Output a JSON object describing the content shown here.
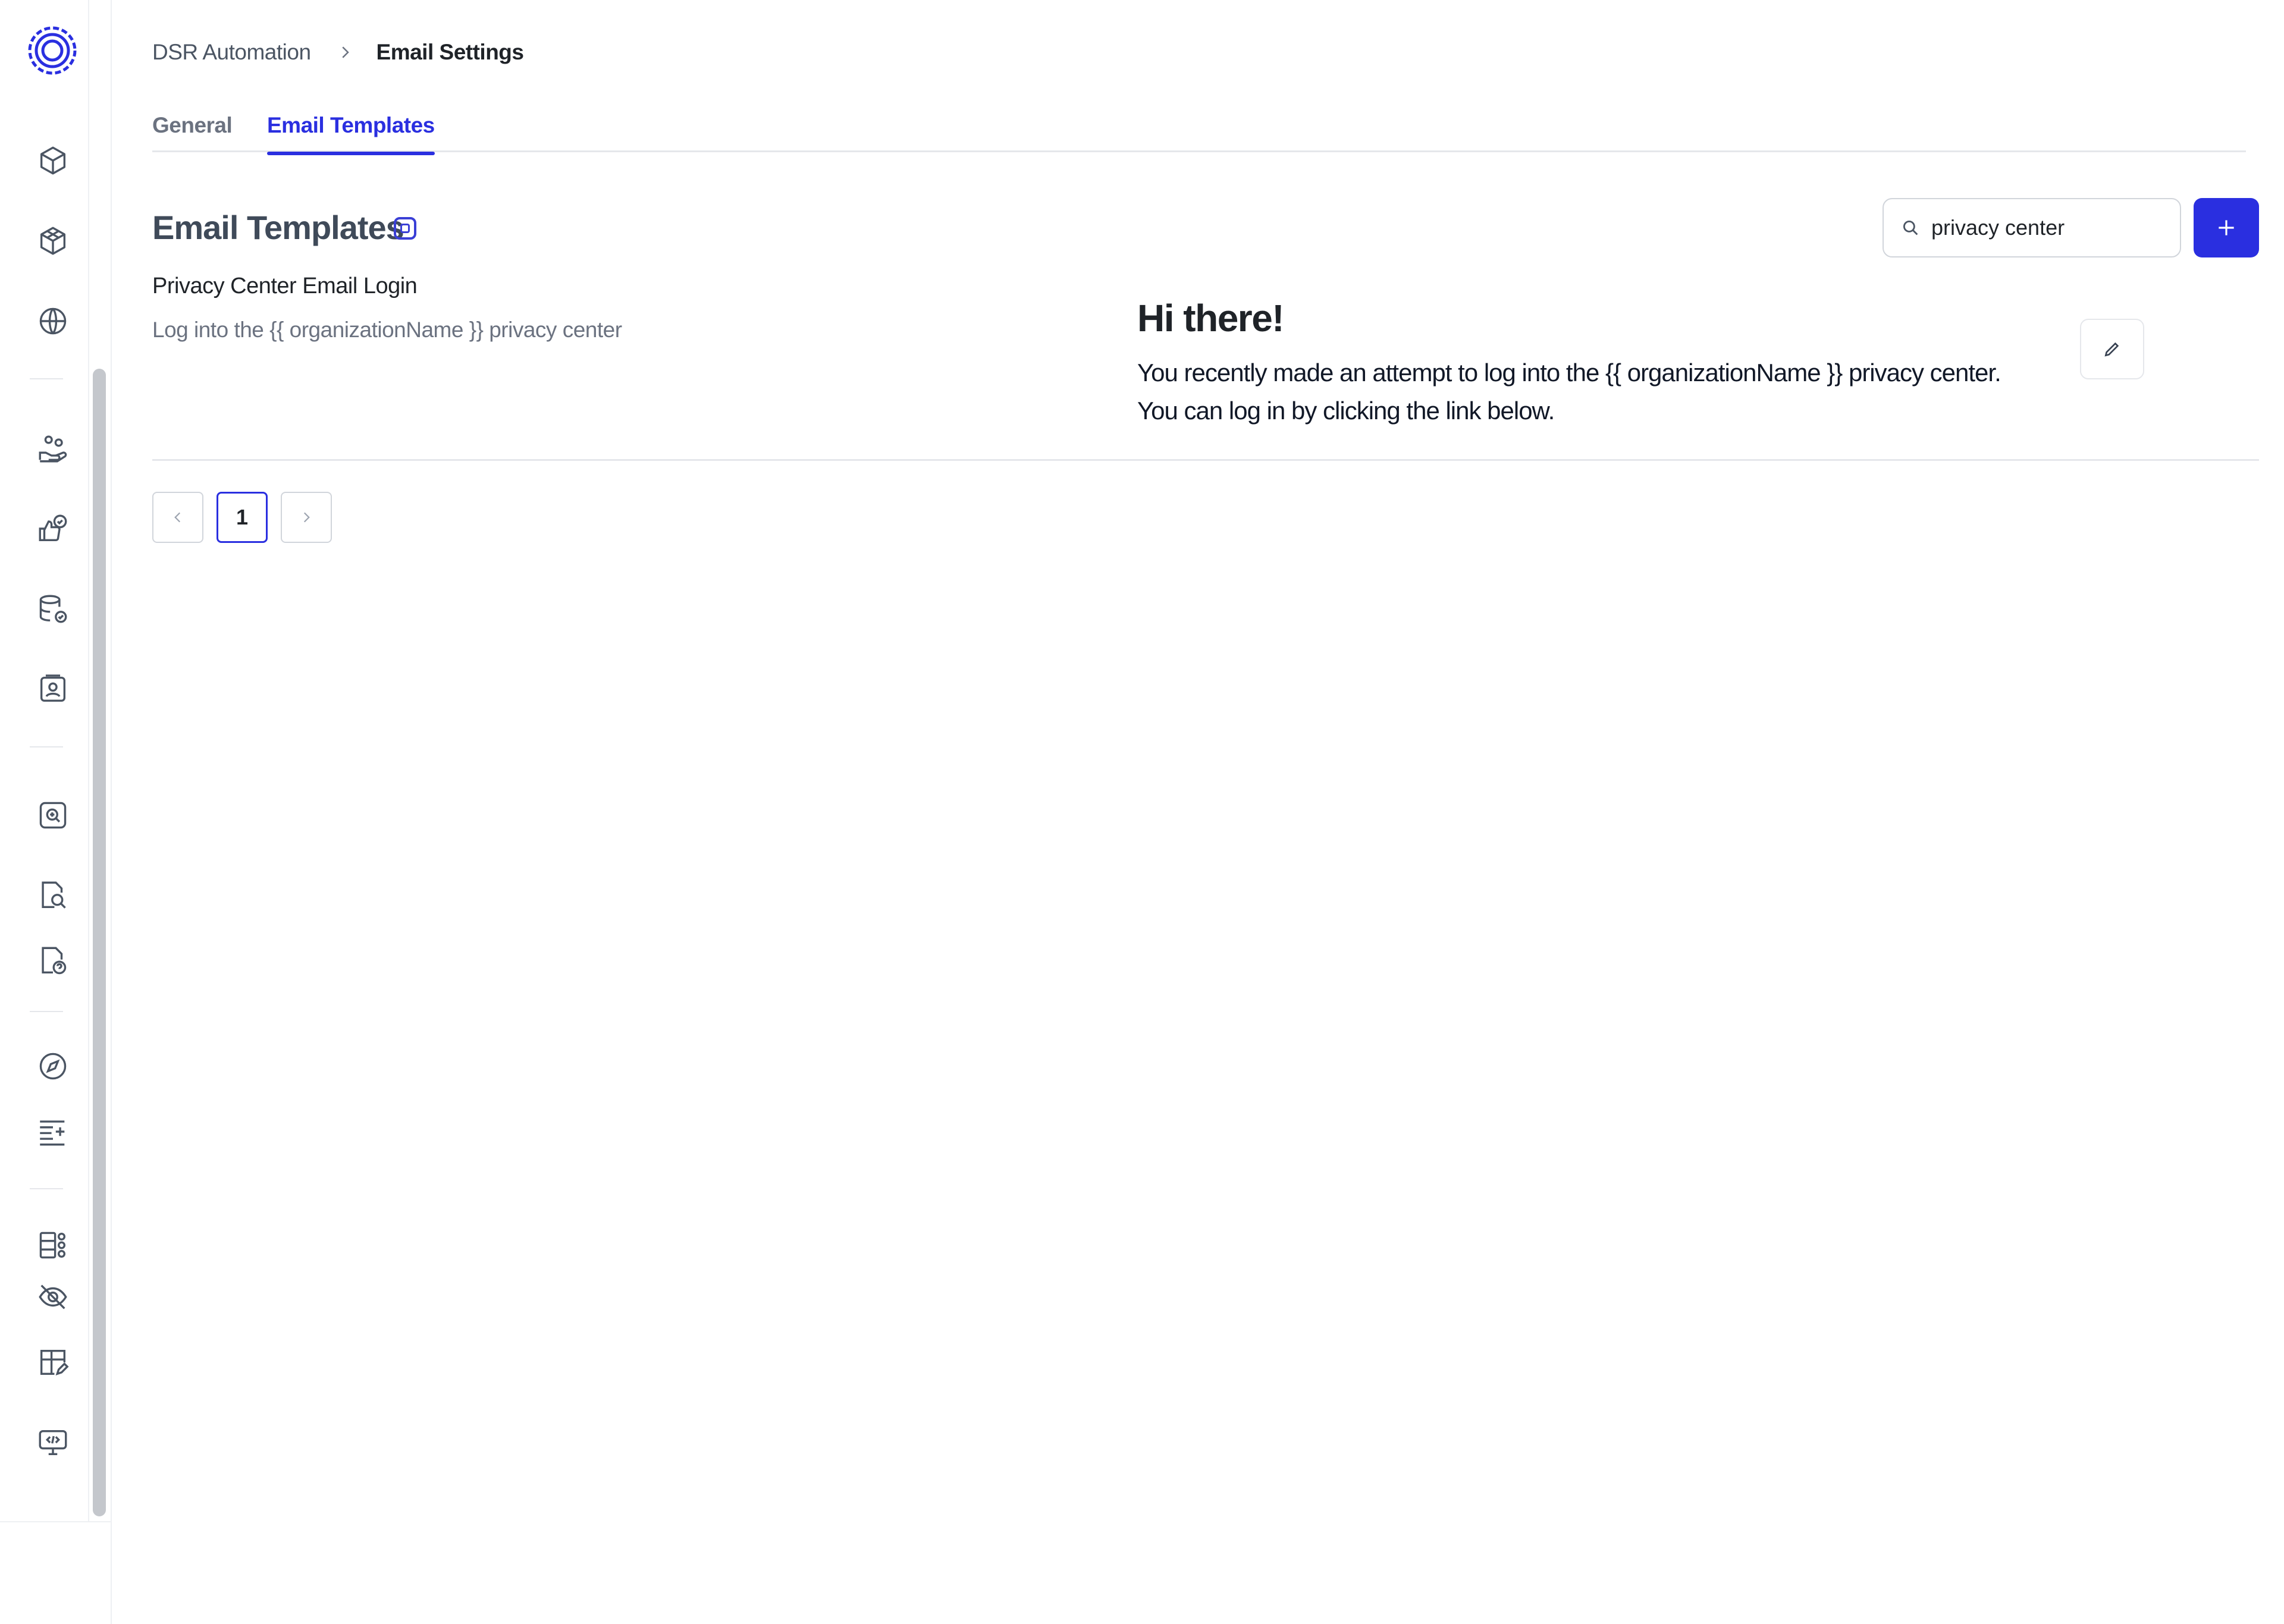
{
  "breadcrumb": {
    "parent": "DSR Automation",
    "current": "Email Settings"
  },
  "tabs": [
    {
      "label": "General",
      "active": false
    },
    {
      "label": "Email Templates",
      "active": true
    }
  ],
  "section": {
    "title": "Email Templates"
  },
  "search": {
    "value": "privacy center",
    "placeholder": "Search"
  },
  "templates": [
    {
      "name": "Privacy Center Email Login",
      "description": "Log into the {{ organizationName }} privacy center",
      "preview_heading": "Hi there!",
      "preview_body_line1": "You recently made an attempt to log into the {{ organizationName }} privacy center.",
      "preview_body_line2": "You can log in by clicking the link below."
    }
  ],
  "pagination": {
    "current_page": "1"
  },
  "sidebar": {
    "icons": [
      "logo-icon",
      "cube-icon",
      "boxes-icon",
      "globe-icon",
      "people-hand-icon",
      "thumbs-check-icon",
      "database-check-icon",
      "id-card-icon",
      "search-square-icon",
      "document-search-icon",
      "document-question-icon",
      "compass-icon",
      "list-sparkle-icon",
      "widgets-icon",
      "eye-off-icon",
      "layout-edit-icon",
      "monitor-code-icon"
    ]
  },
  "colors": {
    "accent": "#2a2fe0",
    "text": "#1f2328",
    "muted": "#6b7280",
    "border": "#e5e7eb"
  }
}
